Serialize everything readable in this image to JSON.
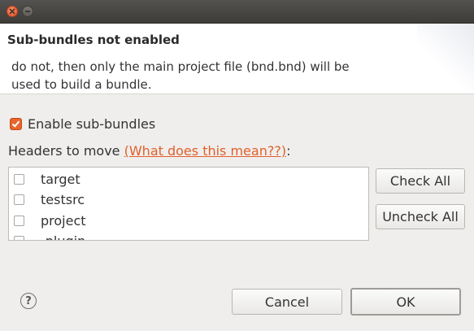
{
  "dialog": {
    "title": "Sub-bundles not enabled",
    "description_line1": "do not, then only the main project file (bnd.bnd) will be",
    "description_line2": "used to build a bundle."
  },
  "enable_checkbox": {
    "label": "Enable sub-bundles",
    "checked": true
  },
  "headers": {
    "label": "Headers to move ",
    "link": "(What does this mean??)",
    "suffix": ":"
  },
  "list": {
    "items": [
      {
        "label": "target",
        "checked": false
      },
      {
        "label": "testsrc",
        "checked": false
      },
      {
        "label": "project",
        "checked": false
      },
      {
        "label": "-plugin",
        "checked": false
      }
    ]
  },
  "buttons": {
    "check_all": "Check All",
    "uncheck_all": "Uncheck All",
    "cancel": "Cancel",
    "ok": "OK"
  },
  "help": {
    "icon": "help-icon",
    "glyph": "?"
  },
  "colors": {
    "accent": "#e8652d",
    "link": "#e0602c",
    "titlebar": "#3d3c38"
  }
}
